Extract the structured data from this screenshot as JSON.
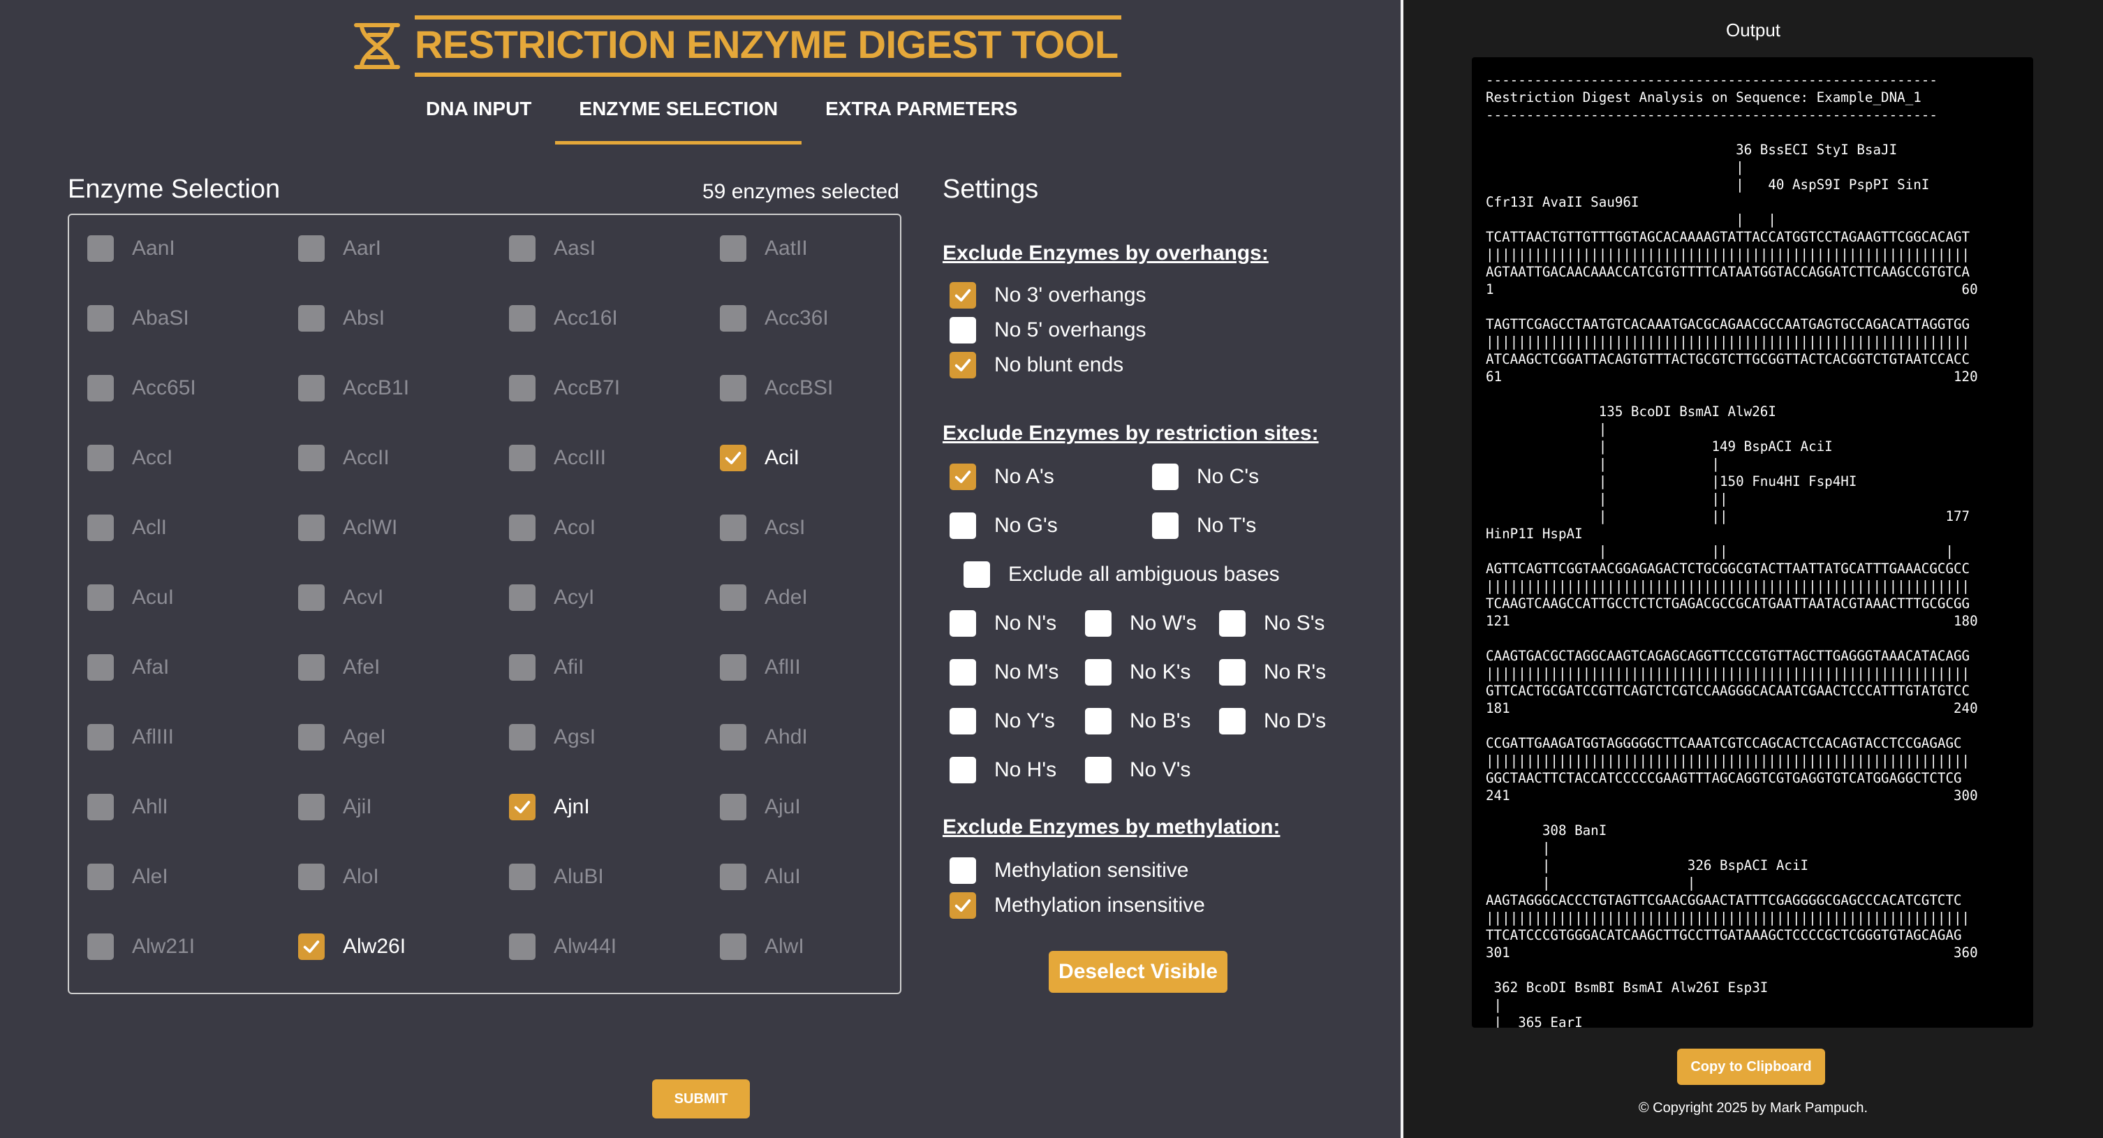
{
  "header": {
    "title": "RESTRICTION ENZYME DIGEST TOOL",
    "logo_icon": "dna-helix-icon",
    "tabs": [
      {
        "label": "DNA INPUT",
        "active": false
      },
      {
        "label": "ENZYME SELECTION",
        "active": true
      },
      {
        "label": "EXTRA PARMETERS",
        "active": false
      }
    ]
  },
  "enzymes": {
    "title": "Enzyme Selection",
    "count_text": "59 enzymes selected",
    "rows": [
      [
        {
          "name": "AanI",
          "checked": false
        },
        {
          "name": "AarI",
          "checked": false
        },
        {
          "name": "AasI",
          "checked": false
        },
        {
          "name": "AatII",
          "checked": false
        }
      ],
      [
        {
          "name": "AbaSI",
          "checked": false
        },
        {
          "name": "AbsI",
          "checked": false
        },
        {
          "name": "Acc16I",
          "checked": false
        },
        {
          "name": "Acc36I",
          "checked": false
        }
      ],
      [
        {
          "name": "Acc65I",
          "checked": false
        },
        {
          "name": "AccB1I",
          "checked": false
        },
        {
          "name": "AccB7I",
          "checked": false
        },
        {
          "name": "AccBSI",
          "checked": false
        }
      ],
      [
        {
          "name": "AccI",
          "checked": false
        },
        {
          "name": "AccII",
          "checked": false
        },
        {
          "name": "AccIII",
          "checked": false
        },
        {
          "name": "AciI",
          "checked": true
        }
      ],
      [
        {
          "name": "AclI",
          "checked": false
        },
        {
          "name": "AclWI",
          "checked": false
        },
        {
          "name": "AcoI",
          "checked": false
        },
        {
          "name": "AcsI",
          "checked": false
        }
      ],
      [
        {
          "name": "AcuI",
          "checked": false
        },
        {
          "name": "AcvI",
          "checked": false
        },
        {
          "name": "AcyI",
          "checked": false
        },
        {
          "name": "AdeI",
          "checked": false
        }
      ],
      [
        {
          "name": "AfaI",
          "checked": false
        },
        {
          "name": "AfeI",
          "checked": false
        },
        {
          "name": "AfiI",
          "checked": false
        },
        {
          "name": "AflII",
          "checked": false
        }
      ],
      [
        {
          "name": "AflIII",
          "checked": false
        },
        {
          "name": "AgeI",
          "checked": false
        },
        {
          "name": "AgsI",
          "checked": false
        },
        {
          "name": "AhdI",
          "checked": false
        }
      ],
      [
        {
          "name": "AhlI",
          "checked": false
        },
        {
          "name": "AjiI",
          "checked": false
        },
        {
          "name": "AjnI",
          "checked": true
        },
        {
          "name": "AjuI",
          "checked": false
        }
      ],
      [
        {
          "name": "AleI",
          "checked": false
        },
        {
          "name": "AloI",
          "checked": false
        },
        {
          "name": "AluBI",
          "checked": false
        },
        {
          "name": "AluI",
          "checked": false
        }
      ],
      [
        {
          "name": "Alw21I",
          "checked": false
        },
        {
          "name": "Alw26I",
          "checked": true
        },
        {
          "name": "Alw44I",
          "checked": false
        },
        {
          "name": "AlwI",
          "checked": false
        }
      ]
    ]
  },
  "settings": {
    "title": "Settings",
    "overhangs": {
      "heading": "Exclude Enzymes by overhangs:",
      "options": [
        {
          "label": "No 3' overhangs",
          "checked": true
        },
        {
          "label": "No 5' overhangs",
          "checked": false
        },
        {
          "label": "No blunt ends",
          "checked": true
        }
      ]
    },
    "sites": {
      "heading": "Exclude Enzymes by restriction sites:",
      "bases": [
        {
          "label": "No A's",
          "checked": true
        },
        {
          "label": "No C's",
          "checked": false
        },
        {
          "label": "No G's",
          "checked": false
        },
        {
          "label": "No T's",
          "checked": false
        }
      ],
      "ambiguous_all": {
        "label": "Exclude all ambiguous bases",
        "checked": false
      },
      "ambiguous": [
        {
          "label": "No N's",
          "checked": false
        },
        {
          "label": "No W's",
          "checked": false
        },
        {
          "label": "No S's",
          "checked": false
        },
        {
          "label": "No M's",
          "checked": false
        },
        {
          "label": "No K's",
          "checked": false
        },
        {
          "label": "No R's",
          "checked": false
        },
        {
          "label": "No Y's",
          "checked": false
        },
        {
          "label": "No B's",
          "checked": false
        },
        {
          "label": "No D's",
          "checked": false
        },
        {
          "label": "No H's",
          "checked": false
        },
        {
          "label": "No V's",
          "checked": false
        }
      ]
    },
    "methylation": {
      "heading": "Exclude Enzymes by methylation:",
      "options": [
        {
          "label": "Methylation sensitive",
          "checked": false
        },
        {
          "label": "Methylation insensitive",
          "checked": true
        }
      ]
    },
    "deselect_button": "Deselect Visible"
  },
  "submit_button": "SUBMIT",
  "output": {
    "title": "Output",
    "text": "--------------------------------------------------------\nRestriction Digest Analysis on Sequence: Example_DNA_1\n--------------------------------------------------------\n\n                               36 BssECI StyI BsaJI\n                               |\n                               |   40 AspS9I PspPI SinI\nCfr13I AvaII Sau96I\n                               |   |\nTCATTAACTGTTGTTTGGTAGCACAAAAGTATTACCATGGTCCTAGAAGTTCGGCACAGT\n||||||||||||||||||||||||||||||||||||||||||||||||||||||||||||\nAGTAATTGACAACAAACCATCGTGTTTTCATAATGGTACCAGGATCTTCAAGCCGTGTCA\n1                                                          60\n\nTAGTTCGAGCCTAATGTCACAAATGACGCAGAACGCCAATGAGTGCCAGACATTAGGTGG\n||||||||||||||||||||||||||||||||||||||||||||||||||||||||||||\nATCAAGCTCGGATTACAGTGTTTACTGCGTCTTGCGGTTACTCACGGTCTGTAATCCACC\n61                                                        120\n\n              135 BcoDI BsmAI Alw26I\n              |\n              |             149 BspACI AciI\n              |             |\n              |             |150 Fnu4HI Fsp4HI\n              |             ||\n              |             ||                           177\nHinP1I HspAI\n              |             ||                           |\nAGTTCAGTTCGGTAACGGAGAGACTCTGCGGCGTACTTAATTATGCATTTGAAACGCGCC\n||||||||||||||||||||||||||||||||||||||||||||||||||||||||||||\nTCAAGTCAAGCCATTGCCTCTCTGAGACGCCGCATGAATTAATACGTAAACTTTGCGCGG\n121                                                       180\n\nCAAGTGACGCTAGGCAAGTCAGAGCAGGTTCCCGTGTTAGCTTGAGGGTAAACATACAGG\n||||||||||||||||||||||||||||||||||||||||||||||||||||||||||||\nGTTCACTGCGATCCGTTCAGTCTCGTCCAAGGGCACAATCGAACTCCCATTTGTATGTCC\n181                                                       240\n\nCCGATTGAAGATGGTAGGGGGCTTCAAATCGTCCAGCACTCCACAGTACCTCCGAGAGC\n||||||||||||||||||||||||||||||||||||||||||||||||||||||||||||\nGGCTAACTTCTACCATCCCCCGAAGTTTAGCAGGTCGTGAGGTGTCATGGAGGCTCTCG\n241                                                       300\n\n       308 BanI\n       |\n       |                 326 BspACI AciI\n       |                 |\nAAGTAGGGCACCCTGTAGTTCGAACGGAACTATTTCGAGGGGCGAGCCCACATCGTCTC\n||||||||||||||||||||||||||||||||||||||||||||||||||||||||||||\nTTCATCCCGTGGGACATCAAGCTTGCCTTGATAAAGCTCCCCGCTCGGGTGTAGCAGAG\n301                                                       360\n\n 362 BcoDI BsmBI BsmAI Alw26I Esp3I\n |\n |  365 EarI",
    "copy_button": "Copy to Clipboard",
    "copyright": "© Copyright 2025 by Mark Pampuch."
  },
  "colors": {
    "accent": "#e5a83a",
    "panel_bg": "#3a3a44",
    "output_bg": "#000000"
  }
}
